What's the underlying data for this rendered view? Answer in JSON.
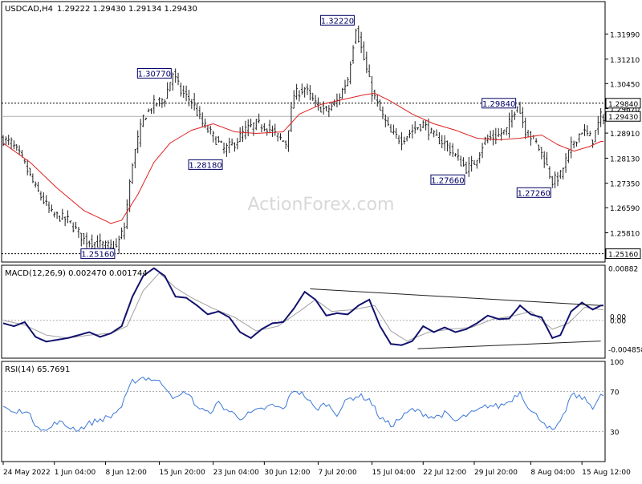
{
  "header": {
    "symbol": "USDCAD,H4",
    "ohlc": "1.29222 1.29430 1.29134 1.29430",
    "macd_label": "MACD(12,26,9) 0.002470 0.001744",
    "rsi_label": "RSI(14) 65.7691"
  },
  "watermark": "ActionForex.com",
  "colors": {
    "candle": "#202020",
    "ma": "#e02020",
    "macd": "#12126e",
    "signal": "#a0a0a0",
    "rsi": "#3a78d8",
    "trendline": "#202020",
    "grid_dash": "#b0b0b0",
    "axis": "#000000",
    "price_box_bg": "#ffffff"
  },
  "chart_data": [
    {
      "type": "line",
      "title": "USDCAD,H4",
      "subtype": "candlestick-ohlc",
      "xlabel": "",
      "ylabel": "",
      "ylim": [
        1.249,
        1.33
      ],
      "x_ticks": [
        "24 May 2022",
        "1 Jun 04:00",
        "8 Jun 12:00",
        "15 Jun 20:00",
        "23 Jun 04:00",
        "30 Jun 12:00",
        "7 Jul 20:00",
        "15 Jul 04:00",
        "22 Jul 12:00",
        "29 Jul 20:00",
        "8 Aug 04:00",
        "15 Aug 12:00"
      ],
      "y_ticks": [
        1.2581,
        1.2659,
        1.2735,
        1.2813,
        1.2891,
        1.2967,
        1.3045,
        1.3121,
        1.3199
      ],
      "dotted_levels": [
        1.2984,
        1.2516
      ],
      "current_price": 1.2943,
      "price_labels": [
        {
          "text": "1.32220",
          "value": 1.3222
        },
        {
          "text": "1.30770",
          "value": 1.3077
        },
        {
          "text": "1.29840",
          "value": 1.2984
        },
        {
          "text": "1.28180",
          "value": 1.2818
        },
        {
          "text": "1.27660",
          "value": 1.2766
        },
        {
          "text": "1.27260",
          "value": 1.2726
        },
        {
          "text": "1.25160",
          "value": 1.2516
        }
      ],
      "axis_box_labels": [
        "1.29840",
        "1.29430",
        "1.25160"
      ],
      "close_path": [
        {
          "i": 0,
          "y": 1.287
        },
        {
          "i": 3,
          "y": 1.286
        },
        {
          "i": 7,
          "y": 1.281
        },
        {
          "i": 12,
          "y": 1.272
        },
        {
          "i": 18,
          "y": 1.264
        },
        {
          "i": 24,
          "y": 1.262
        },
        {
          "i": 30,
          "y": 1.256
        },
        {
          "i": 34,
          "y": 1.255
        },
        {
          "i": 38,
          "y": 1.254
        },
        {
          "i": 42,
          "y": 1.2535
        },
        {
          "i": 45,
          "y": 1.26
        },
        {
          "i": 48,
          "y": 1.28
        },
        {
          "i": 52,
          "y": 1.294
        },
        {
          "i": 56,
          "y": 1.298
        },
        {
          "i": 60,
          "y": 1.3
        },
        {
          "i": 63,
          "y": 1.3077
        },
        {
          "i": 66,
          "y": 1.302
        },
        {
          "i": 70,
          "y": 1.299
        },
        {
          "i": 74,
          "y": 1.292
        },
        {
          "i": 78,
          "y": 1.288
        },
        {
          "i": 82,
          "y": 1.284
        },
        {
          "i": 86,
          "y": 1.286
        },
        {
          "i": 90,
          "y": 1.29
        },
        {
          "i": 94,
          "y": 1.292
        },
        {
          "i": 98,
          "y": 1.291
        },
        {
          "i": 102,
          "y": 1.288
        },
        {
          "i": 105,
          "y": 1.286
        },
        {
          "i": 108,
          "y": 1.301
        },
        {
          "i": 112,
          "y": 1.303
        },
        {
          "i": 116,
          "y": 1.298
        },
        {
          "i": 120,
          "y": 1.296
        },
        {
          "i": 124,
          "y": 1.299
        },
        {
          "i": 128,
          "y": 1.306
        },
        {
          "i": 131,
          "y": 1.3222
        },
        {
          "i": 134,
          "y": 1.312
        },
        {
          "i": 137,
          "y": 1.302
        },
        {
          "i": 140,
          "y": 1.296
        },
        {
          "i": 144,
          "y": 1.289
        },
        {
          "i": 148,
          "y": 1.287
        },
        {
          "i": 152,
          "y": 1.29
        },
        {
          "i": 156,
          "y": 1.292
        },
        {
          "i": 160,
          "y": 1.288
        },
        {
          "i": 164,
          "y": 1.286
        },
        {
          "i": 168,
          "y": 1.282
        },
        {
          "i": 172,
          "y": 1.278
        },
        {
          "i": 175,
          "y": 1.28
        },
        {
          "i": 179,
          "y": 1.287
        },
        {
          "i": 183,
          "y": 1.288
        },
        {
          "i": 187,
          "y": 1.29
        },
        {
          "i": 191,
          "y": 1.2984
        },
        {
          "i": 194,
          "y": 1.29
        },
        {
          "i": 198,
          "y": 1.286
        },
        {
          "i": 201,
          "y": 1.281
        },
        {
          "i": 204,
          "y": 1.274
        },
        {
          "i": 207,
          "y": 1.276
        },
        {
          "i": 211,
          "y": 1.285
        },
        {
          "i": 215,
          "y": 1.29
        },
        {
          "i": 219,
          "y": 1.287
        },
        {
          "i": 222,
          "y": 1.2943
        }
      ],
      "ma_path": [
        {
          "i": 0,
          "y": 1.286
        },
        {
          "i": 10,
          "y": 1.28
        },
        {
          "i": 20,
          "y": 1.272
        },
        {
          "i": 30,
          "y": 1.265
        },
        {
          "i": 40,
          "y": 1.261
        },
        {
          "i": 44,
          "y": 1.262
        },
        {
          "i": 50,
          "y": 1.27
        },
        {
          "i": 56,
          "y": 1.28
        },
        {
          "i": 62,
          "y": 1.286
        },
        {
          "i": 70,
          "y": 1.29
        },
        {
          "i": 78,
          "y": 1.292
        },
        {
          "i": 86,
          "y": 1.2895
        },
        {
          "i": 94,
          "y": 1.289
        },
        {
          "i": 104,
          "y": 1.2895
        },
        {
          "i": 110,
          "y": 1.295
        },
        {
          "i": 118,
          "y": 1.298
        },
        {
          "i": 126,
          "y": 1.2995
        },
        {
          "i": 134,
          "y": 1.301
        },
        {
          "i": 138,
          "y": 1.3015
        },
        {
          "i": 144,
          "y": 1.299
        },
        {
          "i": 152,
          "y": 1.295
        },
        {
          "i": 160,
          "y": 1.292
        },
        {
          "i": 168,
          "y": 1.29
        },
        {
          "i": 176,
          "y": 1.2875
        },
        {
          "i": 184,
          "y": 1.287
        },
        {
          "i": 192,
          "y": 1.2875
        },
        {
          "i": 200,
          "y": 1.2885
        },
        {
          "i": 206,
          "y": 1.2855
        },
        {
          "i": 212,
          "y": 1.2835
        },
        {
          "i": 218,
          "y": 1.285
        },
        {
          "i": 222,
          "y": 1.2865
        }
      ]
    },
    {
      "type": "line",
      "title": "MACD(12,26,9) 0.002470 0.001744",
      "ylim": [
        -0.0064,
        0.0093
      ],
      "y_ticks": [
        0.00882,
        -0.004858
      ],
      "axis_value_labels": [
        "0.00",
        "0.00"
      ],
      "macd_path": [
        {
          "i": 0,
          "y": -0.0005
        },
        {
          "i": 4,
          "y": -0.001
        },
        {
          "i": 8,
          "y": -0.0003
        },
        {
          "i": 12,
          "y": -0.0028
        },
        {
          "i": 16,
          "y": -0.0036
        },
        {
          "i": 20,
          "y": -0.0033
        },
        {
          "i": 24,
          "y": -0.003
        },
        {
          "i": 28,
          "y": -0.0025
        },
        {
          "i": 32,
          "y": -0.002
        },
        {
          "i": 36,
          "y": -0.0028
        },
        {
          "i": 40,
          "y": -0.0022
        },
        {
          "i": 44,
          "y": -0.001
        },
        {
          "i": 48,
          "y": 0.004
        },
        {
          "i": 52,
          "y": 0.0075
        },
        {
          "i": 56,
          "y": 0.0088
        },
        {
          "i": 60,
          "y": 0.0075
        },
        {
          "i": 64,
          "y": 0.004
        },
        {
          "i": 68,
          "y": 0.0038
        },
        {
          "i": 72,
          "y": 0.0025
        },
        {
          "i": 76,
          "y": 0.001
        },
        {
          "i": 80,
          "y": 0.0015
        },
        {
          "i": 84,
          "y": 0.0005
        },
        {
          "i": 88,
          "y": -0.002
        },
        {
          "i": 92,
          "y": -0.003
        },
        {
          "i": 96,
          "y": -0.0015
        },
        {
          "i": 100,
          "y": -0.0005
        },
        {
          "i": 104,
          "y": -0.0003
        },
        {
          "i": 108,
          "y": 0.002
        },
        {
          "i": 112,
          "y": 0.0048
        },
        {
          "i": 116,
          "y": 0.0035
        },
        {
          "i": 120,
          "y": 0.0008
        },
        {
          "i": 124,
          "y": 0.0012
        },
        {
          "i": 128,
          "y": 0.001
        },
        {
          "i": 132,
          "y": 0.0025
        },
        {
          "i": 136,
          "y": 0.0035
        },
        {
          "i": 140,
          "y": -0.001
        },
        {
          "i": 144,
          "y": -0.004
        },
        {
          "i": 148,
          "y": -0.0042
        },
        {
          "i": 152,
          "y": -0.0035
        },
        {
          "i": 156,
          "y": -0.001
        },
        {
          "i": 160,
          "y": -0.002
        },
        {
          "i": 164,
          "y": -0.0012
        },
        {
          "i": 168,
          "y": -0.002
        },
        {
          "i": 172,
          "y": -0.0015
        },
        {
          "i": 176,
          "y": -0.0005
        },
        {
          "i": 180,
          "y": 0.0008
        },
        {
          "i": 184,
          "y": 0.0002
        },
        {
          "i": 188,
          "y": 0.0003
        },
        {
          "i": 192,
          "y": 0.0025
        },
        {
          "i": 196,
          "y": 0.001
        },
        {
          "i": 200,
          "y": 0.0005
        },
        {
          "i": 204,
          "y": -0.003
        },
        {
          "i": 207,
          "y": -0.0025
        },
        {
          "i": 211,
          "y": 0.0015
        },
        {
          "i": 215,
          "y": 0.003
        },
        {
          "i": 219,
          "y": 0.0018
        },
        {
          "i": 222,
          "y": 0.0025
        }
      ],
      "signal_path": [
        {
          "i": 0,
          "y": 0.0
        },
        {
          "i": 8,
          "y": -0.0008
        },
        {
          "i": 16,
          "y": -0.0025
        },
        {
          "i": 24,
          "y": -0.003
        },
        {
          "i": 32,
          "y": -0.0025
        },
        {
          "i": 40,
          "y": -0.0022
        },
        {
          "i": 46,
          "y": -0.001
        },
        {
          "i": 52,
          "y": 0.005
        },
        {
          "i": 58,
          "y": 0.008
        },
        {
          "i": 64,
          "y": 0.0055
        },
        {
          "i": 70,
          "y": 0.0038
        },
        {
          "i": 78,
          "y": 0.002
        },
        {
          "i": 86,
          "y": 0.0005
        },
        {
          "i": 94,
          "y": -0.0018
        },
        {
          "i": 102,
          "y": -0.001
        },
        {
          "i": 110,
          "y": 0.0015
        },
        {
          "i": 116,
          "y": 0.0035
        },
        {
          "i": 122,
          "y": 0.0015
        },
        {
          "i": 130,
          "y": 0.0018
        },
        {
          "i": 138,
          "y": 0.0025
        },
        {
          "i": 144,
          "y": -0.0018
        },
        {
          "i": 150,
          "y": -0.0035
        },
        {
          "i": 158,
          "y": -0.002
        },
        {
          "i": 166,
          "y": -0.0015
        },
        {
          "i": 174,
          "y": -0.0012
        },
        {
          "i": 182,
          "y": 0.0002
        },
        {
          "i": 190,
          "y": 0.0008
        },
        {
          "i": 196,
          "y": 0.0015
        },
        {
          "i": 204,
          "y": -0.0015
        },
        {
          "i": 210,
          "y": -0.0005
        },
        {
          "i": 216,
          "y": 0.0022
        },
        {
          "i": 222,
          "y": 0.0018
        }
      ],
      "trendline_upper": [
        {
          "i": 114,
          "y": 0.0053
        },
        {
          "i": 222,
          "y": 0.0025
        }
      ],
      "trendline_lower": [
        {
          "i": 154,
          "y": -0.0048
        },
        {
          "i": 222,
          "y": -0.0035
        }
      ]
    },
    {
      "type": "line",
      "title": "RSI(14) 65.7691",
      "ylim": [
        0,
        100
      ],
      "y_ticks": [
        100,
        70,
        30
      ],
      "dotted_levels": [
        70,
        30
      ],
      "rsi_path": [
        {
          "i": 0,
          "y": 55
        },
        {
          "i": 4,
          "y": 48
        },
        {
          "i": 8,
          "y": 52
        },
        {
          "i": 12,
          "y": 38
        },
        {
          "i": 16,
          "y": 30
        },
        {
          "i": 20,
          "y": 40
        },
        {
          "i": 24,
          "y": 35
        },
        {
          "i": 28,
          "y": 32
        },
        {
          "i": 32,
          "y": 38
        },
        {
          "i": 36,
          "y": 42
        },
        {
          "i": 40,
          "y": 45
        },
        {
          "i": 44,
          "y": 55
        },
        {
          "i": 48,
          "y": 80
        },
        {
          "i": 52,
          "y": 84
        },
        {
          "i": 56,
          "y": 82
        },
        {
          "i": 60,
          "y": 76
        },
        {
          "i": 64,
          "y": 62
        },
        {
          "i": 68,
          "y": 70
        },
        {
          "i": 72,
          "y": 55
        },
        {
          "i": 76,
          "y": 48
        },
        {
          "i": 80,
          "y": 58
        },
        {
          "i": 84,
          "y": 50
        },
        {
          "i": 88,
          "y": 44
        },
        {
          "i": 92,
          "y": 48
        },
        {
          "i": 96,
          "y": 52
        },
        {
          "i": 100,
          "y": 56
        },
        {
          "i": 104,
          "y": 52
        },
        {
          "i": 108,
          "y": 72
        },
        {
          "i": 112,
          "y": 66
        },
        {
          "i": 116,
          "y": 52
        },
        {
          "i": 120,
          "y": 58
        },
        {
          "i": 124,
          "y": 48
        },
        {
          "i": 128,
          "y": 62
        },
        {
          "i": 132,
          "y": 66
        },
        {
          "i": 136,
          "y": 62
        },
        {
          "i": 140,
          "y": 44
        },
        {
          "i": 144,
          "y": 36
        },
        {
          "i": 148,
          "y": 44
        },
        {
          "i": 152,
          "y": 52
        },
        {
          "i": 156,
          "y": 48
        },
        {
          "i": 160,
          "y": 44
        },
        {
          "i": 164,
          "y": 48
        },
        {
          "i": 168,
          "y": 40
        },
        {
          "i": 172,
          "y": 46
        },
        {
          "i": 176,
          "y": 50
        },
        {
          "i": 180,
          "y": 56
        },
        {
          "i": 184,
          "y": 55
        },
        {
          "i": 188,
          "y": 60
        },
        {
          "i": 192,
          "y": 70
        },
        {
          "i": 196,
          "y": 50
        },
        {
          "i": 200,
          "y": 42
        },
        {
          "i": 204,
          "y": 30
        },
        {
          "i": 207,
          "y": 38
        },
        {
          "i": 211,
          "y": 66
        },
        {
          "i": 215,
          "y": 64
        },
        {
          "i": 219,
          "y": 55
        },
        {
          "i": 222,
          "y": 65.77
        }
      ]
    }
  ]
}
